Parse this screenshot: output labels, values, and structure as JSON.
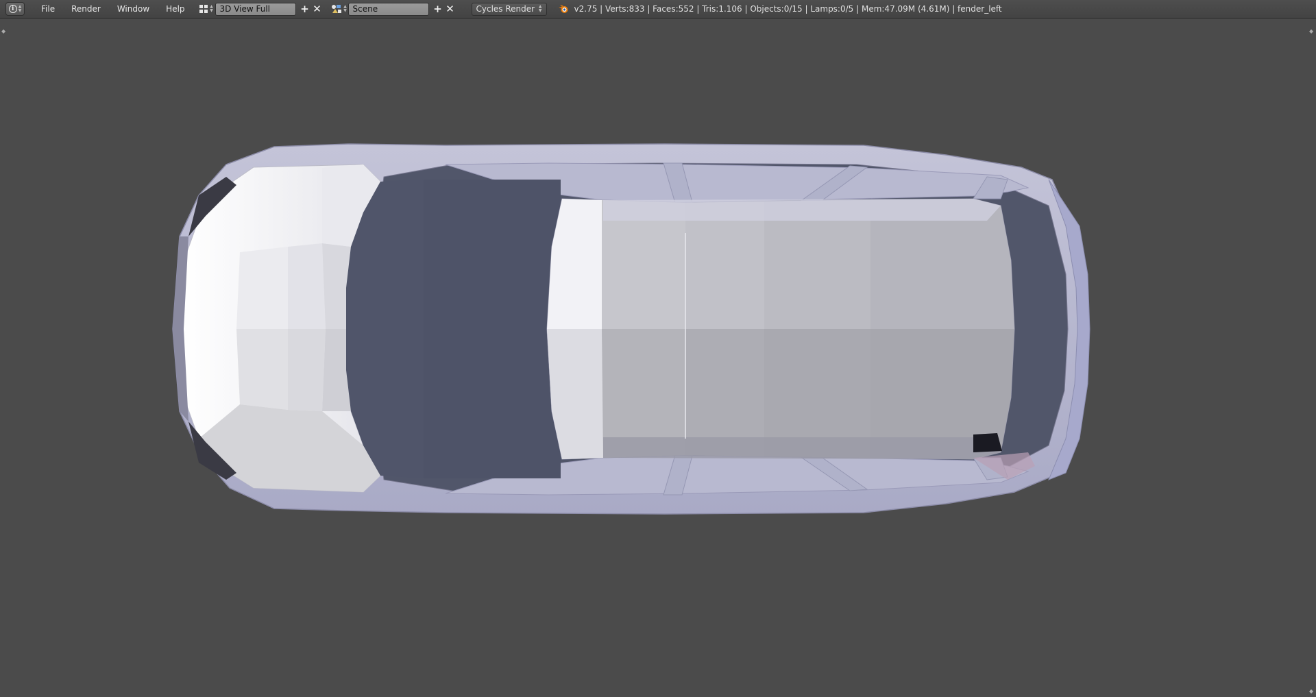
{
  "header": {
    "editor_type_icon": "info-icon",
    "menu": [
      {
        "label": "File"
      },
      {
        "label": "Render"
      },
      {
        "label": "Window"
      },
      {
        "label": "Help"
      }
    ],
    "screen_layout": {
      "icon": "layout-grid-icon",
      "value": "3D View Full",
      "add_icon": "plus-icon",
      "close_icon": "close-icon"
    },
    "scene": {
      "icon": "scene-icon",
      "value": "Scene",
      "add_icon": "plus-icon",
      "close_icon": "close-icon"
    },
    "render_engine": {
      "value": "Cycles Render"
    },
    "stats": {
      "logo_icon": "blender-logo-icon",
      "text": "v2.75 | Verts:833 | Faces:552 | Tris:1.106 | Objects:0/15 | Lamps:0/5 | Mem:47.09M (4.61M) | fender_left"
    }
  },
  "viewport": {
    "background": "#4b4b4b",
    "model": "car-body-top-view"
  }
}
